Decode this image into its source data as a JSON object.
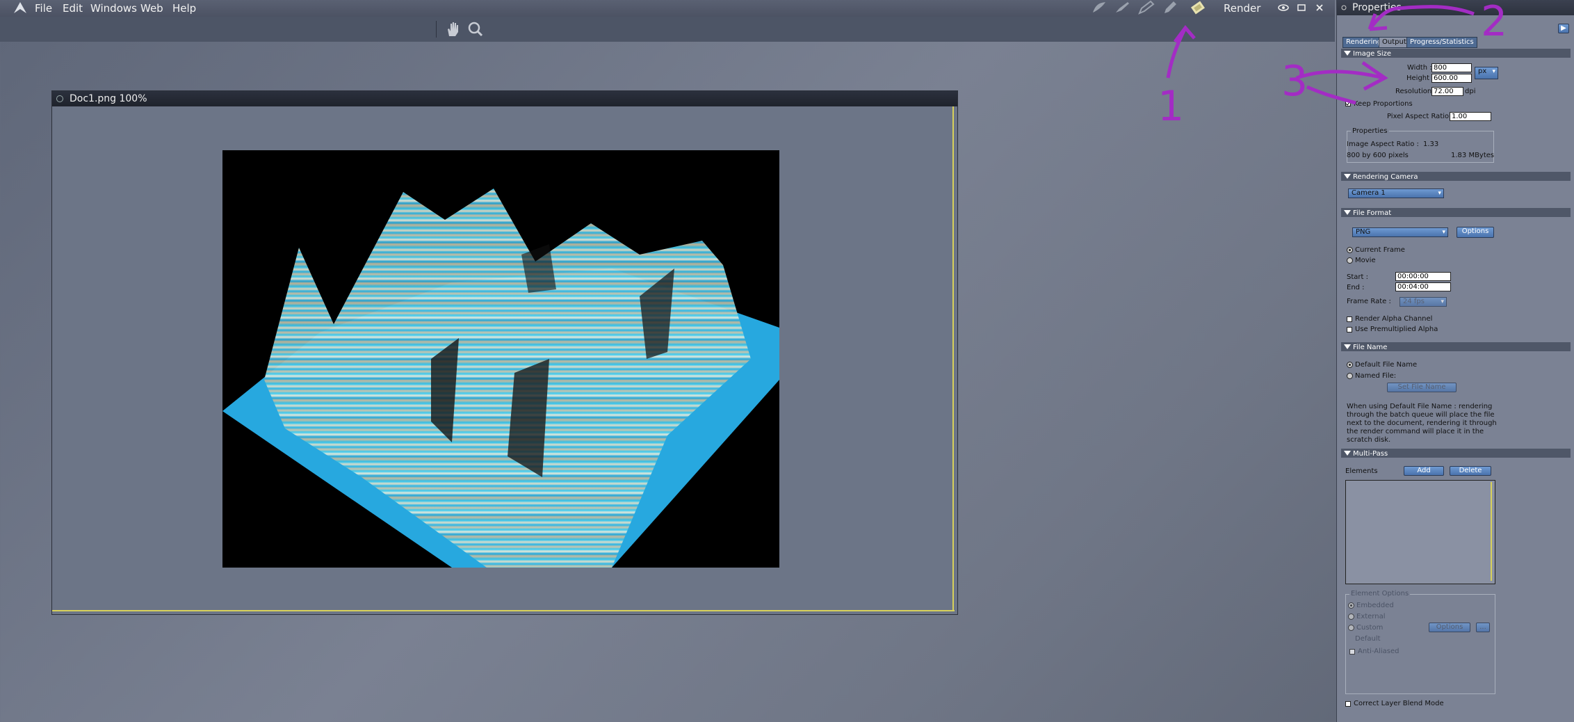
{
  "menu": {
    "items": [
      "File",
      "Edit",
      "Windows",
      "Web",
      "Help"
    ]
  },
  "topbar": {
    "mode_label": "Render",
    "icons": [
      "hand-icon",
      "zoom-icon",
      "paint-icon",
      "brush-icon",
      "pen-icon",
      "pencil-icon",
      "render-icon",
      "eye-icon",
      "maximize-icon",
      "close-icon"
    ]
  },
  "document": {
    "title": "Doc1.png 100%"
  },
  "panel": {
    "title": "Properties",
    "tabs": [
      "Rendering",
      "Output",
      "Progress/Statistics"
    ],
    "image_size": {
      "header": "Image Size",
      "width_label": "Width :",
      "width_value": "800",
      "height_label": "Height :",
      "height_value": "600.00",
      "unit": "px",
      "resolution_label": "Resolution :",
      "resolution_value": "72.00",
      "resolution_unit": "dpi",
      "keep_proportions": "Keep Proportions",
      "pixel_aspect_label": "Pixel Aspect Ratio :",
      "pixel_aspect_value": "1.00",
      "properties_label": "Properties",
      "image_aspect_label": "Image Aspect Ratio :",
      "image_aspect_value": "1.33",
      "pixels_text": "800 by 600 pixels",
      "size_text": "1.83 MBytes"
    },
    "camera": {
      "header": "Rendering Camera",
      "value": "Camera 1"
    },
    "file_format": {
      "header": "File Format",
      "format": "PNG",
      "options": "Options",
      "current_frame": "Current Frame",
      "movie": "Movie",
      "start_label": "Start :",
      "start_value": "00:00:00",
      "end_label": "End :",
      "end_value": "00:04:00",
      "frame_rate_label": "Frame Rate :",
      "frame_rate_value": "24 fps",
      "alpha": "Render Alpha Channel",
      "premult": "Use Premultiplied Alpha"
    },
    "file_name": {
      "header": "File Name",
      "default": "Default File Name",
      "named": "Named File:",
      "set_button": "Set File Name",
      "note": "When using Default File Name : rendering through the batch queue will place the file next to the document, rendering it through the render command will place it in the scratch disk."
    },
    "multipass": {
      "header": "Multi-Pass",
      "elements_label": "Elements",
      "add": "Add",
      "delete": "Delete",
      "element_options": "Element Options",
      "embedded": "Embedded",
      "external": "External",
      "custom": "Custom",
      "default": "Default",
      "options": "Options",
      "more": "...",
      "anti_aliased": "Anti-Aliased",
      "blend_mode": "Correct Layer Blend Mode"
    }
  },
  "annotations": [
    "1",
    "2",
    "3"
  ],
  "colors": {
    "annotation": "#a32cc4",
    "accent_button": "#4a73ad"
  }
}
